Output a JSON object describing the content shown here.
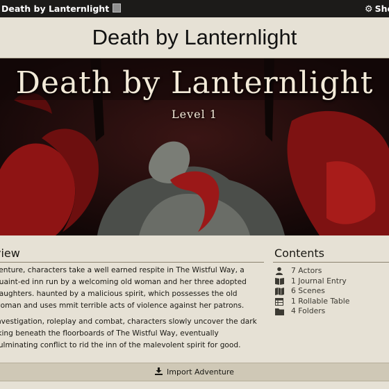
{
  "window": {
    "title": "Death by Lanternlight",
    "sheet_label": "Sheet"
  },
  "header": {
    "title": "Death by Lanternlight"
  },
  "banner": {
    "title": "Death by Lanternlight",
    "subtitle": "Level 1"
  },
  "overview": {
    "heading": "view",
    "paragraphs": [
      "venture, characters take a well earned respite in The Wistful Way, a quaint-ed inn run by a welcoming old woman and her three adopted daughters. haunted by a malicious spirit, which possesses the old woman and uses mmit terrible acts of violence against her patrons.",
      "investigation, roleplay and combat, characters slowly uncover the dark rking beneath the floorboards of The Wistful Way, eventually culminating conflict to rid the inn of the malevolent spirit for good."
    ]
  },
  "contents": {
    "heading": "Contents",
    "items": [
      {
        "icon": "user-icon",
        "label": "7 Actors"
      },
      {
        "icon": "book-icon",
        "label": "1 Journal Entry"
      },
      {
        "icon": "map-icon",
        "label": "6 Scenes"
      },
      {
        "icon": "table-icon",
        "label": "1 Rollable Table"
      },
      {
        "icon": "folder-icon",
        "label": "4 Folders"
      }
    ]
  },
  "footer": {
    "import_label": "Import Adventure"
  },
  "colors": {
    "topbar": "#1c1b19",
    "page": "#e6e1d5",
    "import_bar": "#cfc8b6",
    "banner_red": "#8e1414"
  }
}
